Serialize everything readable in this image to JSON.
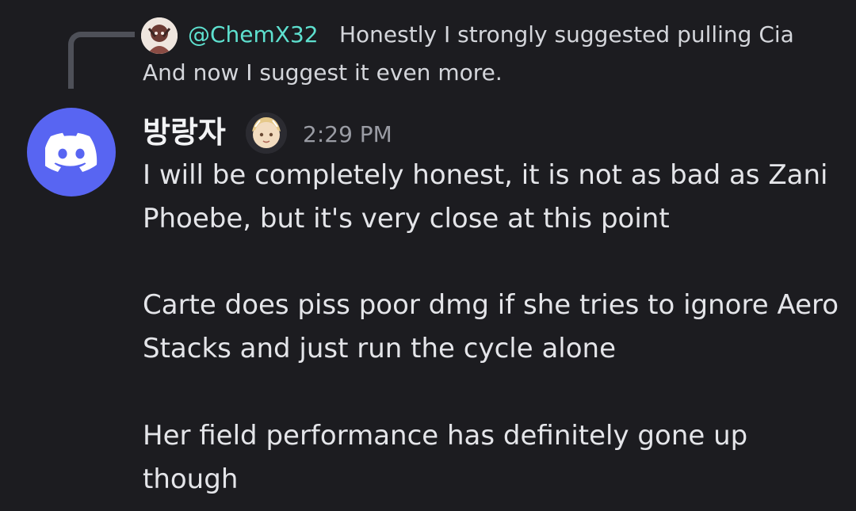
{
  "reply": {
    "author": "@ChemX32",
    "text_line1": "Honestly I strongly suggested pulling Cia",
    "text_line2": "And now I suggest it even more."
  },
  "message": {
    "author": "방랑자",
    "timestamp": "2:29 PM",
    "lines": [
      "I will be completely honest, it is not as bad as Zani",
      "Phoebe, but it's very close at this point",
      "Carte does piss poor dmg if she tries to ignore Aero",
      "Stacks and just run the cycle alone",
      "Her field performance has definitely gone up",
      "though"
    ]
  },
  "colors": {
    "background": "#1c1c20",
    "reply_author": "#5ee0cf",
    "avatar_blurple": "#5865f2",
    "timestamp": "#9a9ca4"
  },
  "icons": {
    "main_avatar": "discord-logo-icon",
    "reply_avatar": "user-avatar",
    "author_badge": "character-avatar-badge"
  }
}
